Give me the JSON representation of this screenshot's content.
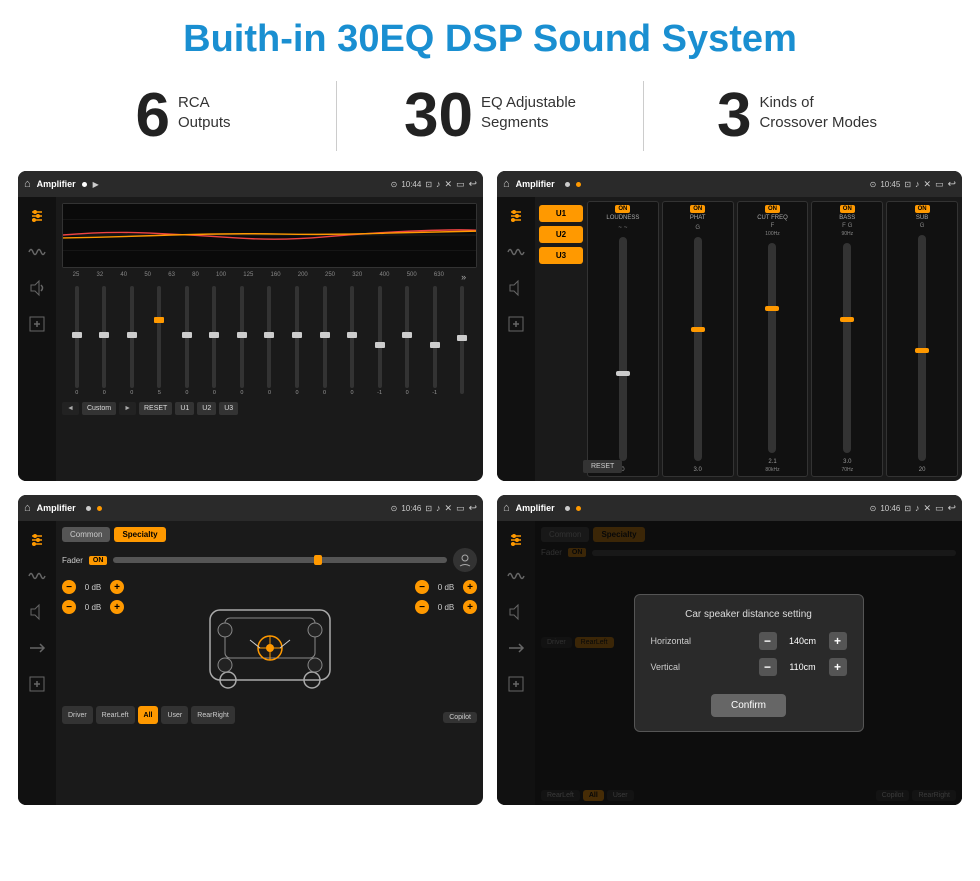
{
  "page": {
    "title": "Buith-in 30EQ DSP Sound System"
  },
  "stats": [
    {
      "number": "6",
      "label": "RCA\nOutputs"
    },
    {
      "number": "30",
      "label": "EQ Adjustable\nSegments"
    },
    {
      "number": "3",
      "label": "Kinds of\nCrossover Modes"
    }
  ],
  "screen1": {
    "title": "Amplifier",
    "time": "10:44",
    "eq_freqs": [
      "25",
      "32",
      "40",
      "50",
      "63",
      "80",
      "100",
      "125",
      "160",
      "200",
      "250",
      "320",
      "400",
      "500",
      "630"
    ],
    "eq_vals": [
      "0",
      "0",
      "0",
      "5",
      "0",
      "0",
      "0",
      "0",
      "0",
      "0",
      "0",
      "-1",
      "0",
      "-1",
      ""
    ],
    "controls": [
      "◄",
      "Custom",
      "►",
      "RESET",
      "U1",
      "U2",
      "U3"
    ]
  },
  "screen2": {
    "title": "Amplifier",
    "time": "10:45",
    "presets": [
      "U1",
      "U2",
      "U3"
    ],
    "channels": [
      {
        "label": "LOUDNESS",
        "on": true
      },
      {
        "label": "PHAT",
        "on": true
      },
      {
        "label": "CUT FREQ",
        "on": true
      },
      {
        "label": "BASS",
        "on": true
      },
      {
        "label": "SUB",
        "on": true
      }
    ],
    "reset_label": "RESET"
  },
  "screen3": {
    "title": "Amplifier",
    "time": "10:46",
    "tabs": [
      "Common",
      "Specialty"
    ],
    "fader_label": "Fader",
    "fader_on": "ON",
    "volume_rows": [
      {
        "val": "0 dB"
      },
      {
        "val": "0 dB"
      },
      {
        "val": "0 dB"
      },
      {
        "val": "0 dB"
      }
    ],
    "bottom_btns": [
      "Driver",
      "RearLeft",
      "All",
      "User",
      "RearRight",
      "Copilot"
    ]
  },
  "screen4": {
    "title": "Amplifier",
    "time": "10:46",
    "tabs": [
      "Common",
      "Specialty"
    ],
    "dialog": {
      "title": "Car speaker distance setting",
      "horizontal_label": "Horizontal",
      "horizontal_val": "140cm",
      "vertical_label": "Vertical",
      "vertical_val": "110cm",
      "confirm_label": "Confirm"
    },
    "bottom_btns_right": [
      "Copilot",
      "RearRight"
    ],
    "bottom_btns_left": [
      "Driver",
      "RearLeft"
    ]
  }
}
